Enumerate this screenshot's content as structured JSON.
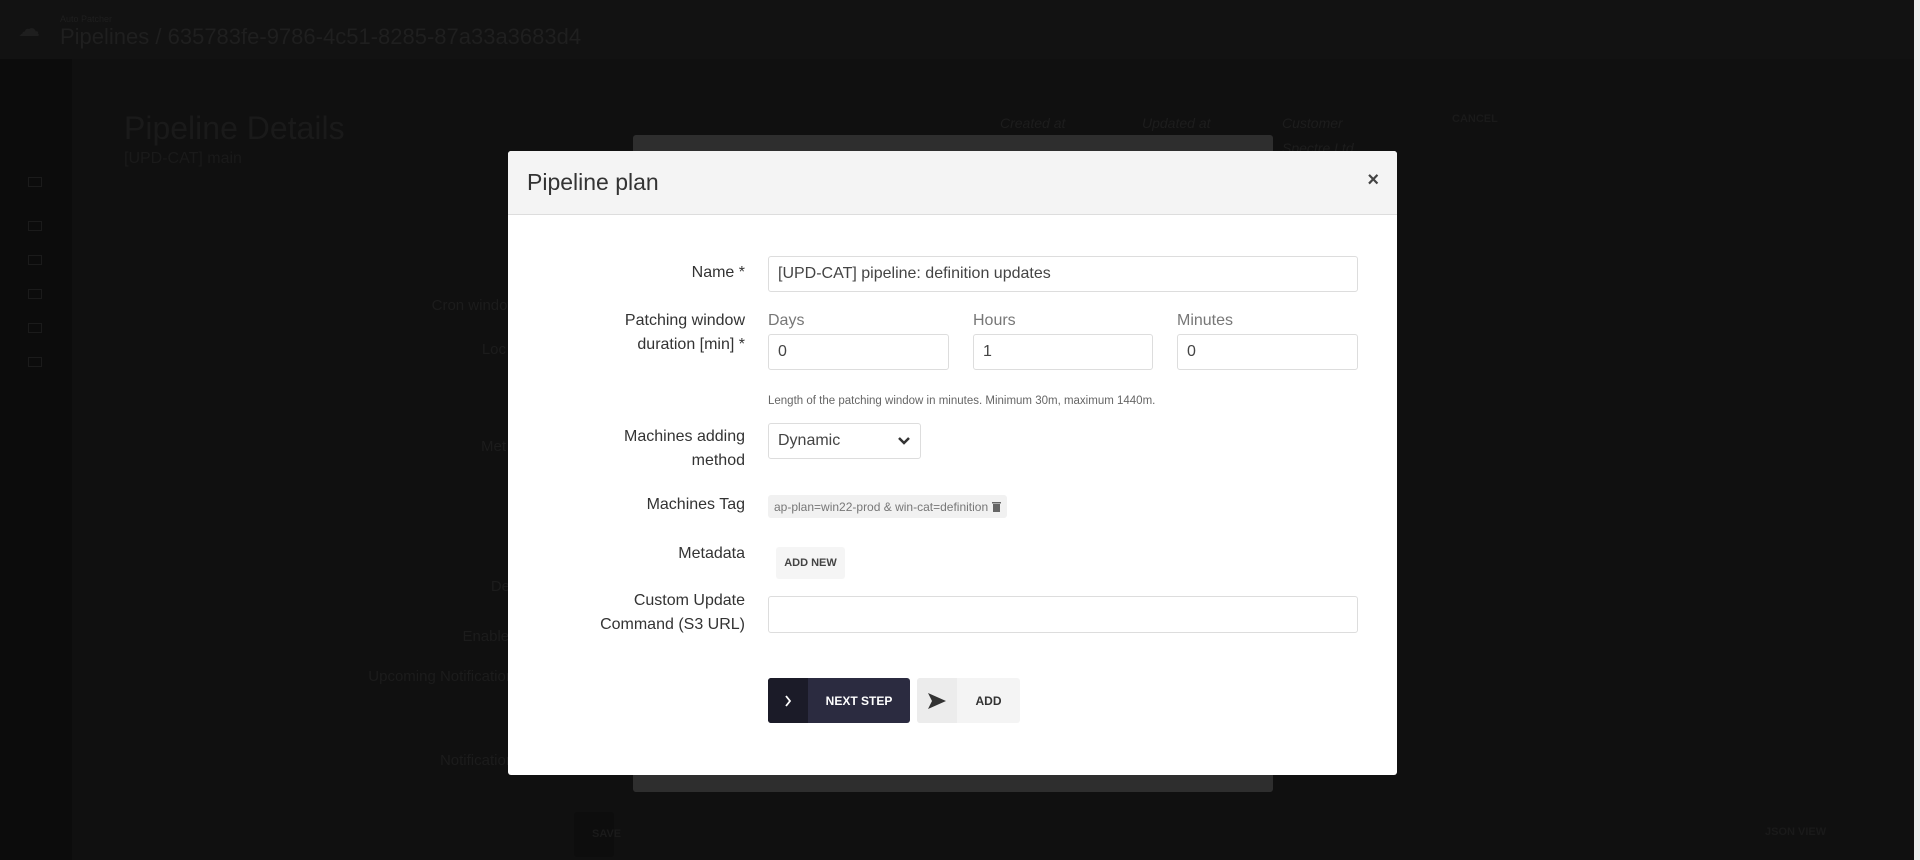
{
  "background": {
    "app_name": "Auto Patcher",
    "breadcrumb": "Pipelines / 635783fe-9786-4c51-8285-87a33a3683d4",
    "page_title": "Pipeline Details",
    "page_subtitle": "[UPD-CAT] main",
    "created_at_label": "Created at",
    "updated_at_label": "Updated at",
    "customer_label": "Customer",
    "customer_value": "Spectre Ltd",
    "cancel_label": "CANCEL",
    "save_label": "SAVE",
    "json_view_label": "JSON VIEW",
    "field_labels": [
      "Na",
      "Cron window s",
      "Loc",
      "St",
      "Met",
      "Descr",
      "Enable ba",
      "Upcoming Notification Ti",
      "Notification G"
    ]
  },
  "modal": {
    "title": "Pipeline plan",
    "close_icon": "×",
    "name_label": "Name *",
    "name_value": "[UPD-CAT] pipeline: definition updates",
    "duration_label_line1": "Patching window",
    "duration_label_line2": "duration [min] *",
    "days_label": "Days",
    "days_value": "0",
    "hours_label": "Hours",
    "hours_value": "1",
    "minutes_label": "Minutes",
    "minutes_value": "0",
    "duration_help": "Length of the patching window in minutes. Minimum 30m, maximum 1440m.",
    "method_label_line1": "Machines adding",
    "method_label_line2": "method",
    "method_value": "Dynamic",
    "tag_label": "Machines Tag",
    "tag_value": "ap-plan=win22-prod & win-cat=definition",
    "metadata_label": "Metadata",
    "add_new_label": "ADD NEW",
    "custom_cmd_label_line1": "Custom Update",
    "custom_cmd_label_line2": "Command (S3 URL)",
    "custom_cmd_value": "",
    "next_step_label": "NEXT STEP",
    "add_label": "ADD"
  },
  "colors": {
    "primary_button": "#2b2b40",
    "primary_button_icon": "#1b1b28",
    "overlay": "#101010"
  }
}
